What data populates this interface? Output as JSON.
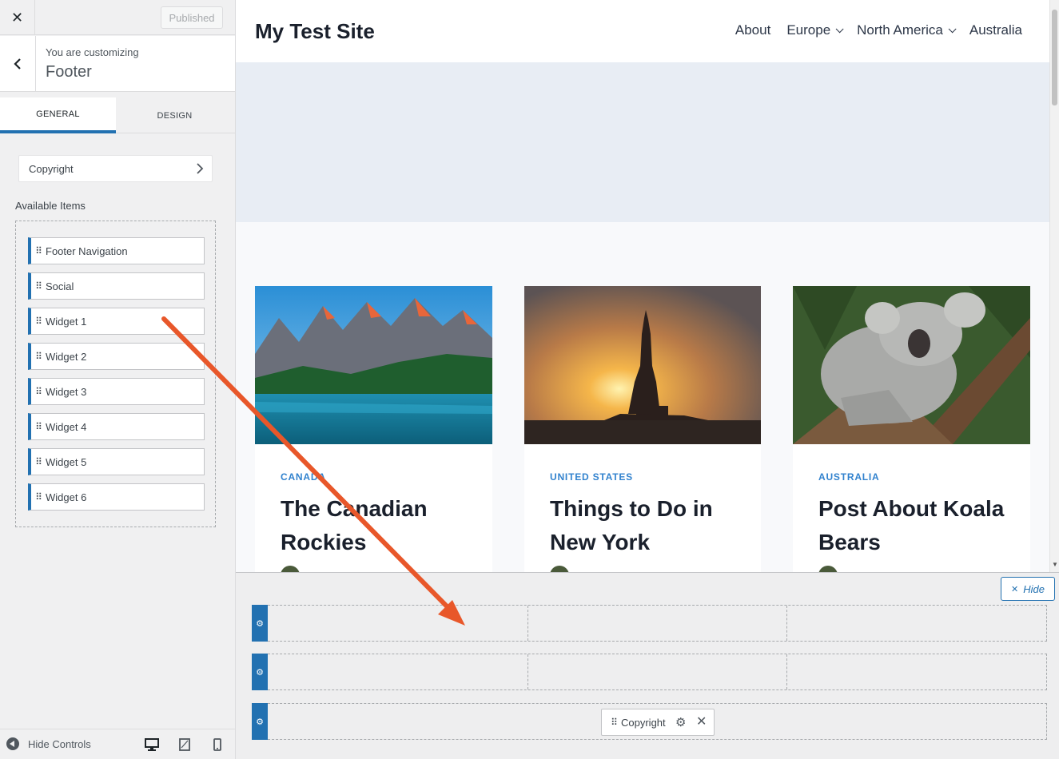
{
  "customizer": {
    "close_glyph": "✕",
    "published_label": "Published",
    "customizing_label": "You are customizing",
    "section_name": "Footer",
    "tabs": [
      {
        "label": "GENERAL",
        "active": true
      },
      {
        "label": "DESIGN",
        "active": false
      }
    ],
    "copyright_row_label": "Copyright",
    "available_items_label": "Available Items",
    "available_items": [
      {
        "label": "Footer Navigation"
      },
      {
        "label": "Social"
      },
      {
        "label": "Widget 1"
      },
      {
        "label": "Widget 2"
      },
      {
        "label": "Widget 3"
      },
      {
        "label": "Widget 4"
      },
      {
        "label": "Widget 5"
      },
      {
        "label": "Widget 6"
      }
    ],
    "hide_controls_label": "Hide Controls",
    "devices": [
      "desktop-icon",
      "tablet-icon",
      "mobile-icon"
    ],
    "accent_color": "#2271b1"
  },
  "preview": {
    "site_title": "My Test Site",
    "nav": [
      {
        "label": "About",
        "has_dropdown": false
      },
      {
        "label": "Europe",
        "has_dropdown": true
      },
      {
        "label": "North America",
        "has_dropdown": true
      },
      {
        "label": "Australia",
        "has_dropdown": false
      }
    ],
    "cards": [
      {
        "category": "CANADA",
        "title": "The Canadian Rockies",
        "image": "mountain-lake-image"
      },
      {
        "category": "UNITED STATES",
        "title": "Things to Do in New York",
        "image": "statue-of-liberty-sunset-image"
      },
      {
        "category": "AUSTRALIA",
        "title": "Post About Koala Bears",
        "image": "koala-image"
      }
    ],
    "category_color": "#3182ce"
  },
  "footer_builder": {
    "hide_label": "Hide",
    "rows": 3,
    "copyright_item_label": "Copyright",
    "annotation_arrow_color": "#e8572a"
  }
}
